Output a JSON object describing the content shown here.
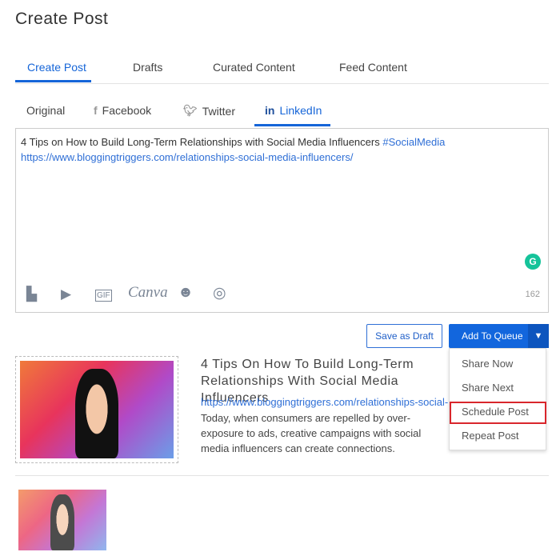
{
  "page": {
    "title": "Create Post"
  },
  "tabs": [
    {
      "label": "Create Post",
      "active": true
    },
    {
      "label": "Drafts"
    },
    {
      "label": "Curated Content"
    },
    {
      "label": "Feed Content"
    }
  ],
  "social_tabs": [
    {
      "label": "Original"
    },
    {
      "label": "Facebook",
      "icon": "facebook-icon"
    },
    {
      "label": "Twitter",
      "icon": "twitter-icon"
    },
    {
      "label": "LinkedIn",
      "icon": "linkedin-icon",
      "active": true
    }
  ],
  "editor": {
    "text": "4 Tips on How to Build Long-Term Relationships with Social Media Influencers ",
    "hashtag": "#SocialMedia",
    "url": "https://www.bloggingtriggers.com/relationships-social-media-influencers/",
    "char_count": "162",
    "tools": [
      "image-icon",
      "video-icon",
      "gif-icon",
      "canva-icon",
      "emoji-icon",
      "target-icon"
    ],
    "canva_label": "Canva"
  },
  "buttons": {
    "save_draft": "Save as Draft",
    "add_queue": "Add To Queue"
  },
  "dropdown": [
    "Share Now",
    "Share Next",
    "Schedule Post",
    "Repeat Post"
  ],
  "preview": {
    "title": "4 Tips On How To Build Long-Term Relationships With Social Media Influencers",
    "url": "https://www.bloggingtriggers.com/relationships-social-media-influencers/",
    "description": "Today, when consumers are repelled by over-exposure to ads, creative campaigns with social media influencers can create connections."
  },
  "colors": {
    "accent": "#1266dd",
    "highlight": "#d9262c"
  }
}
